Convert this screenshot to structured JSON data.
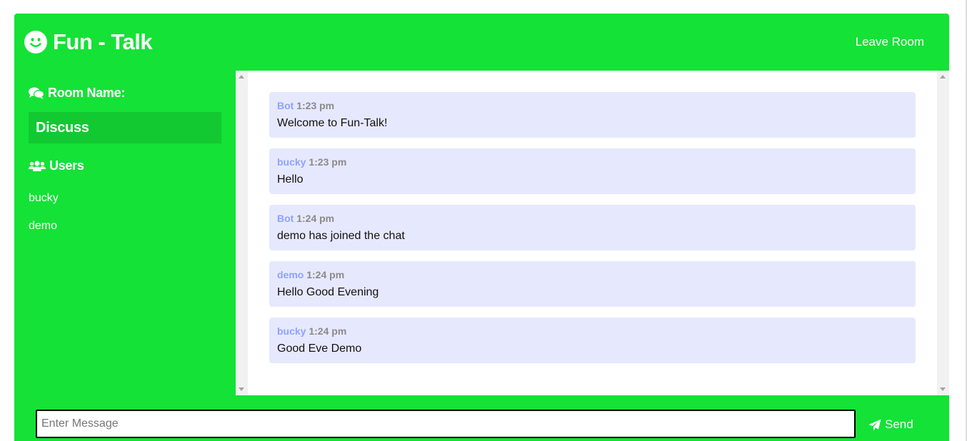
{
  "colors": {
    "brand": "#14e236",
    "room_box": "#12c932",
    "message_bg": "#e6e9fe",
    "username": "#8ea2ff",
    "time": "#8a8a8a"
  },
  "header": {
    "logo_icon": "smile-icon",
    "title": "Fun - Talk",
    "leave_label": "Leave Room"
  },
  "sidebar": {
    "room_label": "Room Name:",
    "room_icon": "comments-icon",
    "room_name": "Discuss",
    "users_label": "Users",
    "users_icon": "users-icon",
    "users": [
      "bucky",
      "demo"
    ]
  },
  "messages": [
    {
      "user": "Bot",
      "time": "1:23 pm",
      "text": "Welcome to Fun-Talk!"
    },
    {
      "user": "bucky",
      "time": "1:23 pm",
      "text": "Hello"
    },
    {
      "user": "Bot",
      "time": "1:24 pm",
      "text": "demo has joined the chat"
    },
    {
      "user": "demo",
      "time": "1:24 pm",
      "text": "Hello Good Evening"
    },
    {
      "user": "bucky",
      "time": "1:24 pm",
      "text": "Good Eve Demo"
    }
  ],
  "footer": {
    "input_placeholder": "Enter Message",
    "input_value": "",
    "send_label": "Send",
    "send_icon": "paper-plane-icon"
  }
}
